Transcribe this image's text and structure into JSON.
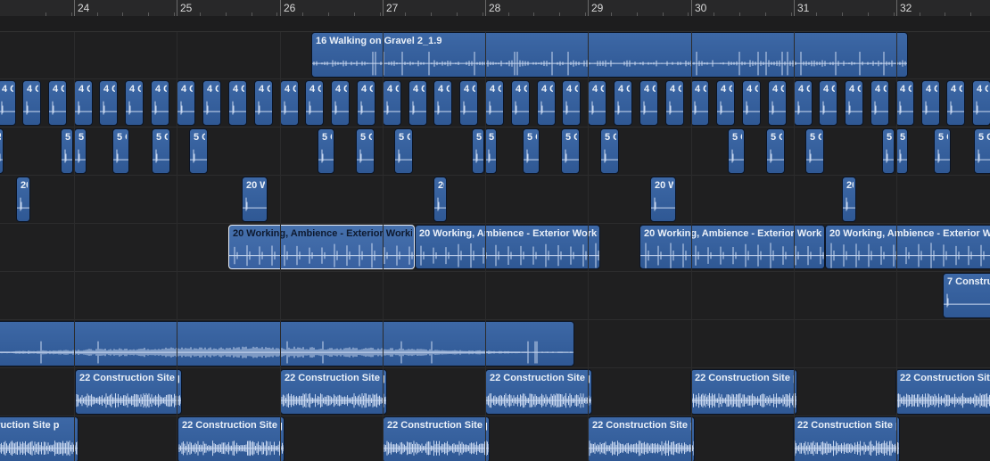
{
  "ruler": {
    "bars": [
      "24",
      "25",
      "26",
      "27",
      "28",
      "29",
      "30",
      "31",
      "32"
    ]
  },
  "regions": {
    "gravel": "16 Walking on Gravel 2_1.9",
    "short4": "4 C",
    "short5": "5 C",
    "short5narrow": "5",
    "short20": "20 W",
    "short20narrow": "20",
    "working": "20 Working, Ambience - Exterior Working",
    "construction7": "7 Constructi",
    "construction22": "22 Construction Site p",
    "construction22left": "onstruction Site p"
  },
  "colors": {
    "background": "#1f1f20",
    "region": "#35609c",
    "waveform": "#c9d8f0",
    "selected_border": "#e9eef6"
  }
}
